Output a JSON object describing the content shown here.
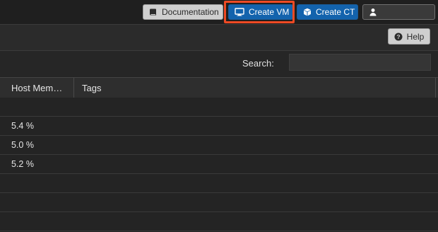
{
  "topbar": {
    "documentation_label": "Documentation",
    "create_vm_label": "Create VM",
    "create_ct_label": "Create CT",
    "user_label": ""
  },
  "panel": {
    "help_label": "Help"
  },
  "search": {
    "label": "Search:",
    "value": "",
    "placeholder": ""
  },
  "table": {
    "columns": [
      "Host Mem…",
      "Tags"
    ],
    "rows": [
      {
        "host_memory": "",
        "tags": ""
      },
      {
        "host_memory": "5.4 %",
        "tags": ""
      },
      {
        "host_memory": "5.0 %",
        "tags": ""
      },
      {
        "host_memory": "5.2 %",
        "tags": ""
      },
      {
        "host_memory": "",
        "tags": ""
      },
      {
        "host_memory": "",
        "tags": ""
      },
      {
        "host_memory": "",
        "tags": ""
      }
    ]
  },
  "icons": {
    "documentation": "book-icon",
    "create_vm": "monitor-icon",
    "create_ct": "cube-icon",
    "user": "user-icon",
    "help": "question-circle-icon"
  },
  "colors": {
    "primary_button": "#1363ad",
    "highlight_border": "#ee4a24",
    "background": "#242424"
  }
}
